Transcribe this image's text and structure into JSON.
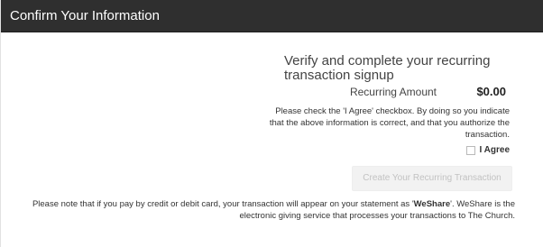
{
  "header": {
    "title": "Confirm Your Information"
  },
  "main": {
    "title": "Verify and complete your recurring transaction signup",
    "recurring_amount_label": "Recurring Amount",
    "recurring_amount_value": "$0.00",
    "agree_instructions": "Please check the 'I Agree' checkbox. By doing so you indicate that the above information is correct, and that you authorize the transaction.",
    "agree_label": "I Agree",
    "agree_checked": false,
    "create_button_label": "Create Your Recurring Transaction",
    "create_button_disabled": true,
    "note_prefix": "Please note that if you pay by credit or debit card, your transaction will appear on your statement as '",
    "note_brand": "WeShare",
    "note_suffix": "'. WeShare is the electronic giving service that processes your transactions to The Church."
  },
  "colors": {
    "header_bg": "#2f2f2f",
    "header_text": "#ffffff",
    "disabled_button_bg": "#f2f2f2",
    "disabled_button_text": "#c2c2c2"
  }
}
